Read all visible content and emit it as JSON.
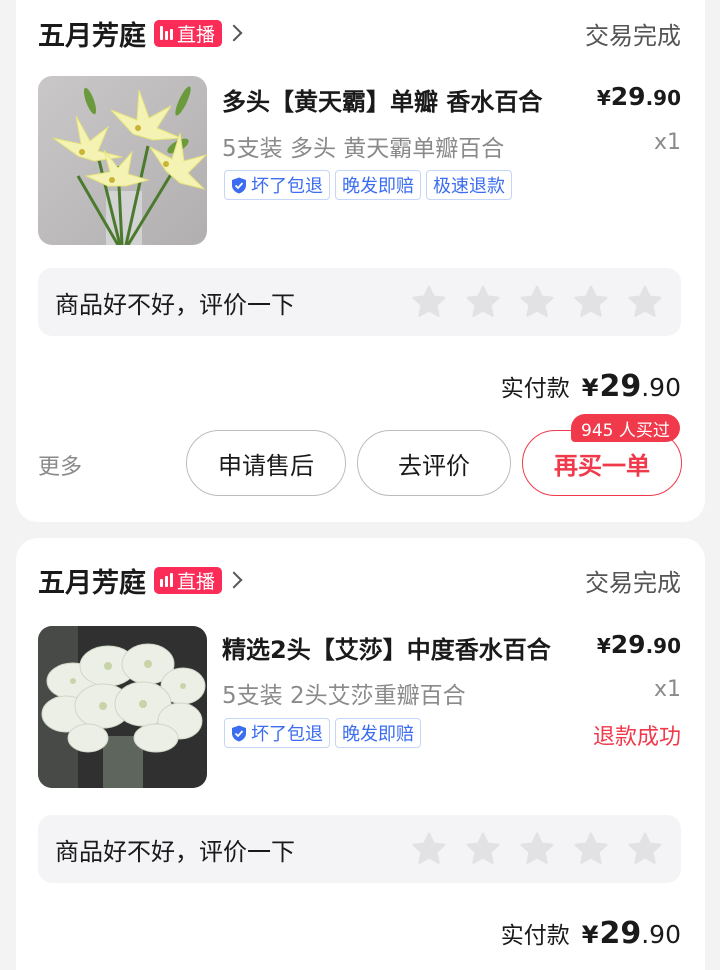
{
  "orders": [
    {
      "shop_name": "五月芳庭",
      "live_label": "直播",
      "status": "交易完成",
      "title": "多头【黄天霸】单瓣 香水百合",
      "price_symbol": "¥",
      "price_int": "29",
      "price_dec": ".90",
      "sku": "5支装 多头 黄天霸单瓣百合",
      "qty": "x1",
      "tags": [
        "坏了包退",
        "晚发即赔",
        "极速退款"
      ],
      "review_prompt": "商品好不好，评价一下",
      "rating_stars": 0,
      "paid_label": "实付款",
      "paid_symbol": "¥",
      "paid_int": "29",
      "paid_dec": ".90",
      "more_label": "更多",
      "buttons": [
        "申请售后",
        "去评价",
        "再买一单"
      ],
      "bought_count": "945 人买过"
    },
    {
      "shop_name": "五月芳庭",
      "live_label": "直播",
      "status": "交易完成",
      "title": "精选2头【艾莎】中度香水百合",
      "price_symbol": "¥",
      "price_int": "29",
      "price_dec": ".90",
      "sku": "5支装 2头艾莎重瓣百合",
      "qty": "x1",
      "tags": [
        "坏了包退",
        "晚发即赔"
      ],
      "refund_status": "退款成功",
      "review_prompt": "商品好不好，评价一下",
      "rating_stars": 0,
      "paid_label": "实付款",
      "paid_symbol": "¥",
      "paid_int": "29",
      "paid_dec": ".90"
    }
  ],
  "colors": {
    "accent": "#f0394b",
    "live": "#fb2c57",
    "tag_blue": "#3c6df0",
    "star_empty": "#e2e2e5"
  },
  "icons": {
    "live": "live-bars-icon",
    "chevron": "chevron-right-icon",
    "shield": "shield-check-icon",
    "star": "star-icon"
  }
}
